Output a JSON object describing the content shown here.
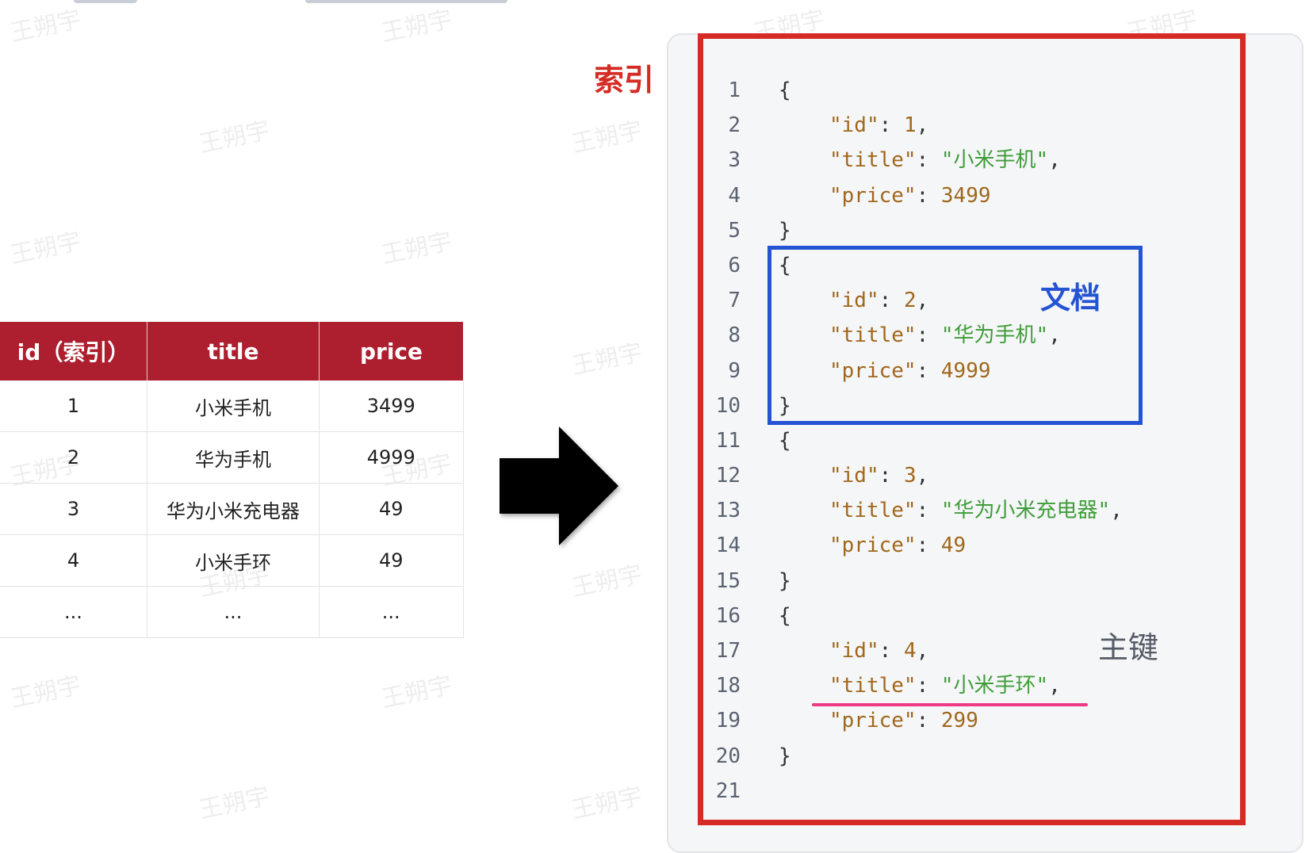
{
  "watermark": "王朔宇",
  "labels": {
    "index": "索引",
    "document": "文档",
    "primary_key": "主键"
  },
  "colors": {
    "index_red": "#d52b25",
    "document_blue": "#2453d3",
    "key_pink": "#ee3a84",
    "table_header": "#ad1f2e"
  },
  "table": {
    "headers": [
      "id（索引）",
      "title",
      "price"
    ],
    "rows": [
      [
        "1",
        "小米手机",
        "3499"
      ],
      [
        "2",
        "华为手机",
        "4999"
      ],
      [
        "3",
        "华为小米充电器",
        "49"
      ],
      [
        "4",
        "小米手环",
        "49"
      ],
      [
        "...",
        "...",
        "..."
      ]
    ]
  },
  "code": {
    "line_numbers": [
      "1",
      "2",
      "3",
      "4",
      "5",
      "6",
      "7",
      "8",
      "9",
      "10",
      "11",
      "12",
      "13",
      "14",
      "15",
      "16",
      "17",
      "18",
      "19",
      "20",
      "21"
    ],
    "documents": [
      {
        "id": "1",
        "title": "\"小米手机\"",
        "price": "3499"
      },
      {
        "id": "2",
        "title": "\"华为手机\"",
        "price": "4999"
      },
      {
        "id": "3",
        "title": "\"华为小米充电器\"",
        "price": "49"
      },
      {
        "id": "4",
        "title": "\"小米手环\"",
        "price": "299"
      }
    ],
    "key_id": "\"id\"",
    "key_title": "\"title\"",
    "key_price": "\"price\"",
    "open_brace": "{",
    "close_brace": "}",
    "colon": ": ",
    "comma": ","
  }
}
